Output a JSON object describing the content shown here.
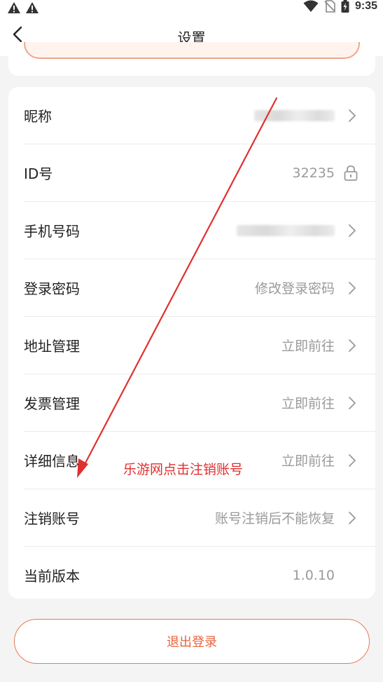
{
  "status_bar": {
    "time": "9:35",
    "left_icons": [
      "warning-icon",
      "warning-icon"
    ],
    "right_icons": [
      "wifi-icon",
      "no-sim-icon",
      "battery-charging-icon"
    ]
  },
  "header": {
    "title": "设置",
    "back_icon": "chevron-left-icon"
  },
  "settings": {
    "rows": [
      {
        "label": "昵称",
        "value": "",
        "value_blurred": true,
        "trailing": "chevron-right-icon"
      },
      {
        "label": "ID号",
        "value": "32235",
        "value_blurred": false,
        "trailing": "lock-icon"
      },
      {
        "label": "手机号码",
        "value": "",
        "value_blurred": true,
        "trailing": "chevron-right-icon"
      },
      {
        "label": "登录密码",
        "value": "修改登录密码",
        "value_blurred": false,
        "trailing": "chevron-right-icon"
      },
      {
        "label": "地址管理",
        "value": "立即前往",
        "value_blurred": false,
        "trailing": "chevron-right-icon"
      },
      {
        "label": "发票管理",
        "value": "立即前往",
        "value_blurred": false,
        "trailing": "chevron-right-icon"
      },
      {
        "label": "详细信息",
        "value": "立即前往",
        "value_blurred": false,
        "trailing": "chevron-right-icon"
      },
      {
        "label": "注销账号",
        "value": "账号注销后不能恢复",
        "value_blurred": false,
        "trailing": "chevron-right-icon"
      },
      {
        "label": "当前版本",
        "value": "1.0.10",
        "value_blurred": false,
        "trailing": ""
      }
    ]
  },
  "annotation": {
    "text": "乐游网点击注销账号",
    "color": "#e0302e"
  },
  "logout": {
    "label": "退出登录",
    "accent_color": "#e8643c"
  }
}
